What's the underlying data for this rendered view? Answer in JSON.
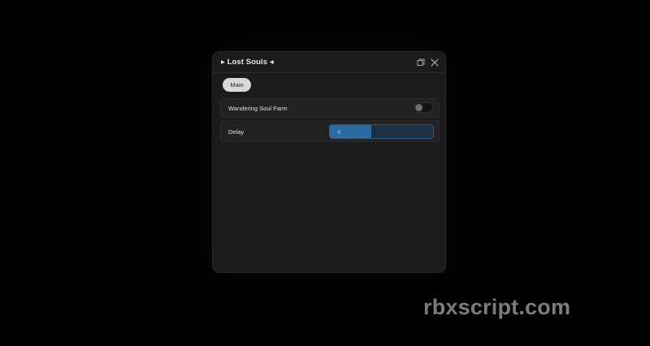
{
  "window": {
    "title": "▸ Lost Souls ◂"
  },
  "tabs": [
    {
      "label": "Main",
      "active": true
    }
  ],
  "controls": {
    "wandering_soul_farm": {
      "label": "Wandering Soul Farm",
      "enabled": false
    },
    "delay": {
      "label": "Delay",
      "value": "4",
      "fill_fraction": 0.4
    }
  },
  "icons": {
    "restore": "restore-icon",
    "close": "close-icon"
  },
  "colors": {
    "background": "#000000",
    "window": "#1b1b1b",
    "row": "#222222",
    "accent": "#2d6aa0",
    "tab_active": "#d9d9d9"
  },
  "watermark": "rbxscript.com"
}
